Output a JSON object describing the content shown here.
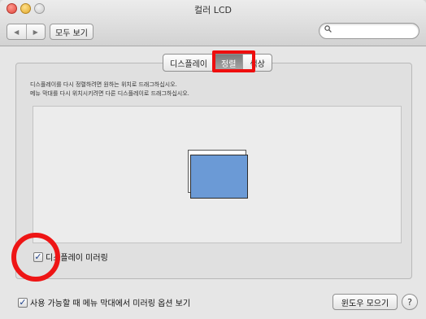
{
  "window": {
    "title": "컬러 LCD"
  },
  "toolbar": {
    "back_icon": "◀",
    "forward_icon": "▶",
    "show_all_label": "모두 보기",
    "search": {
      "value": "",
      "placeholder": ""
    }
  },
  "tabs": [
    {
      "label": "디스플레이",
      "active": false
    },
    {
      "label": "정렬",
      "active": true
    },
    {
      "label": "색상",
      "active": false
    }
  ],
  "instructions": {
    "line1": "디스플레이를 다시 정렬하려면 원하는 위치로 드래그하십시오.",
    "line2": "메뉴 막대를 다시 위치시키려면 다른 디스플레이로 드래그하십시오."
  },
  "mirror_checkbox": {
    "label": "디스플레이 미러링",
    "checked": true
  },
  "menu_checkbox": {
    "label": "사용 가능할 때 메뉴 막대에서 미러링 옵션 보기",
    "checked": true
  },
  "buttons": {
    "gather_windows": "윈도우 모으기",
    "help": "?"
  },
  "colors": {
    "highlight": "#ee0e0e",
    "display_blue": "#6b9ad6",
    "active_tab": "#8c8c8c"
  }
}
